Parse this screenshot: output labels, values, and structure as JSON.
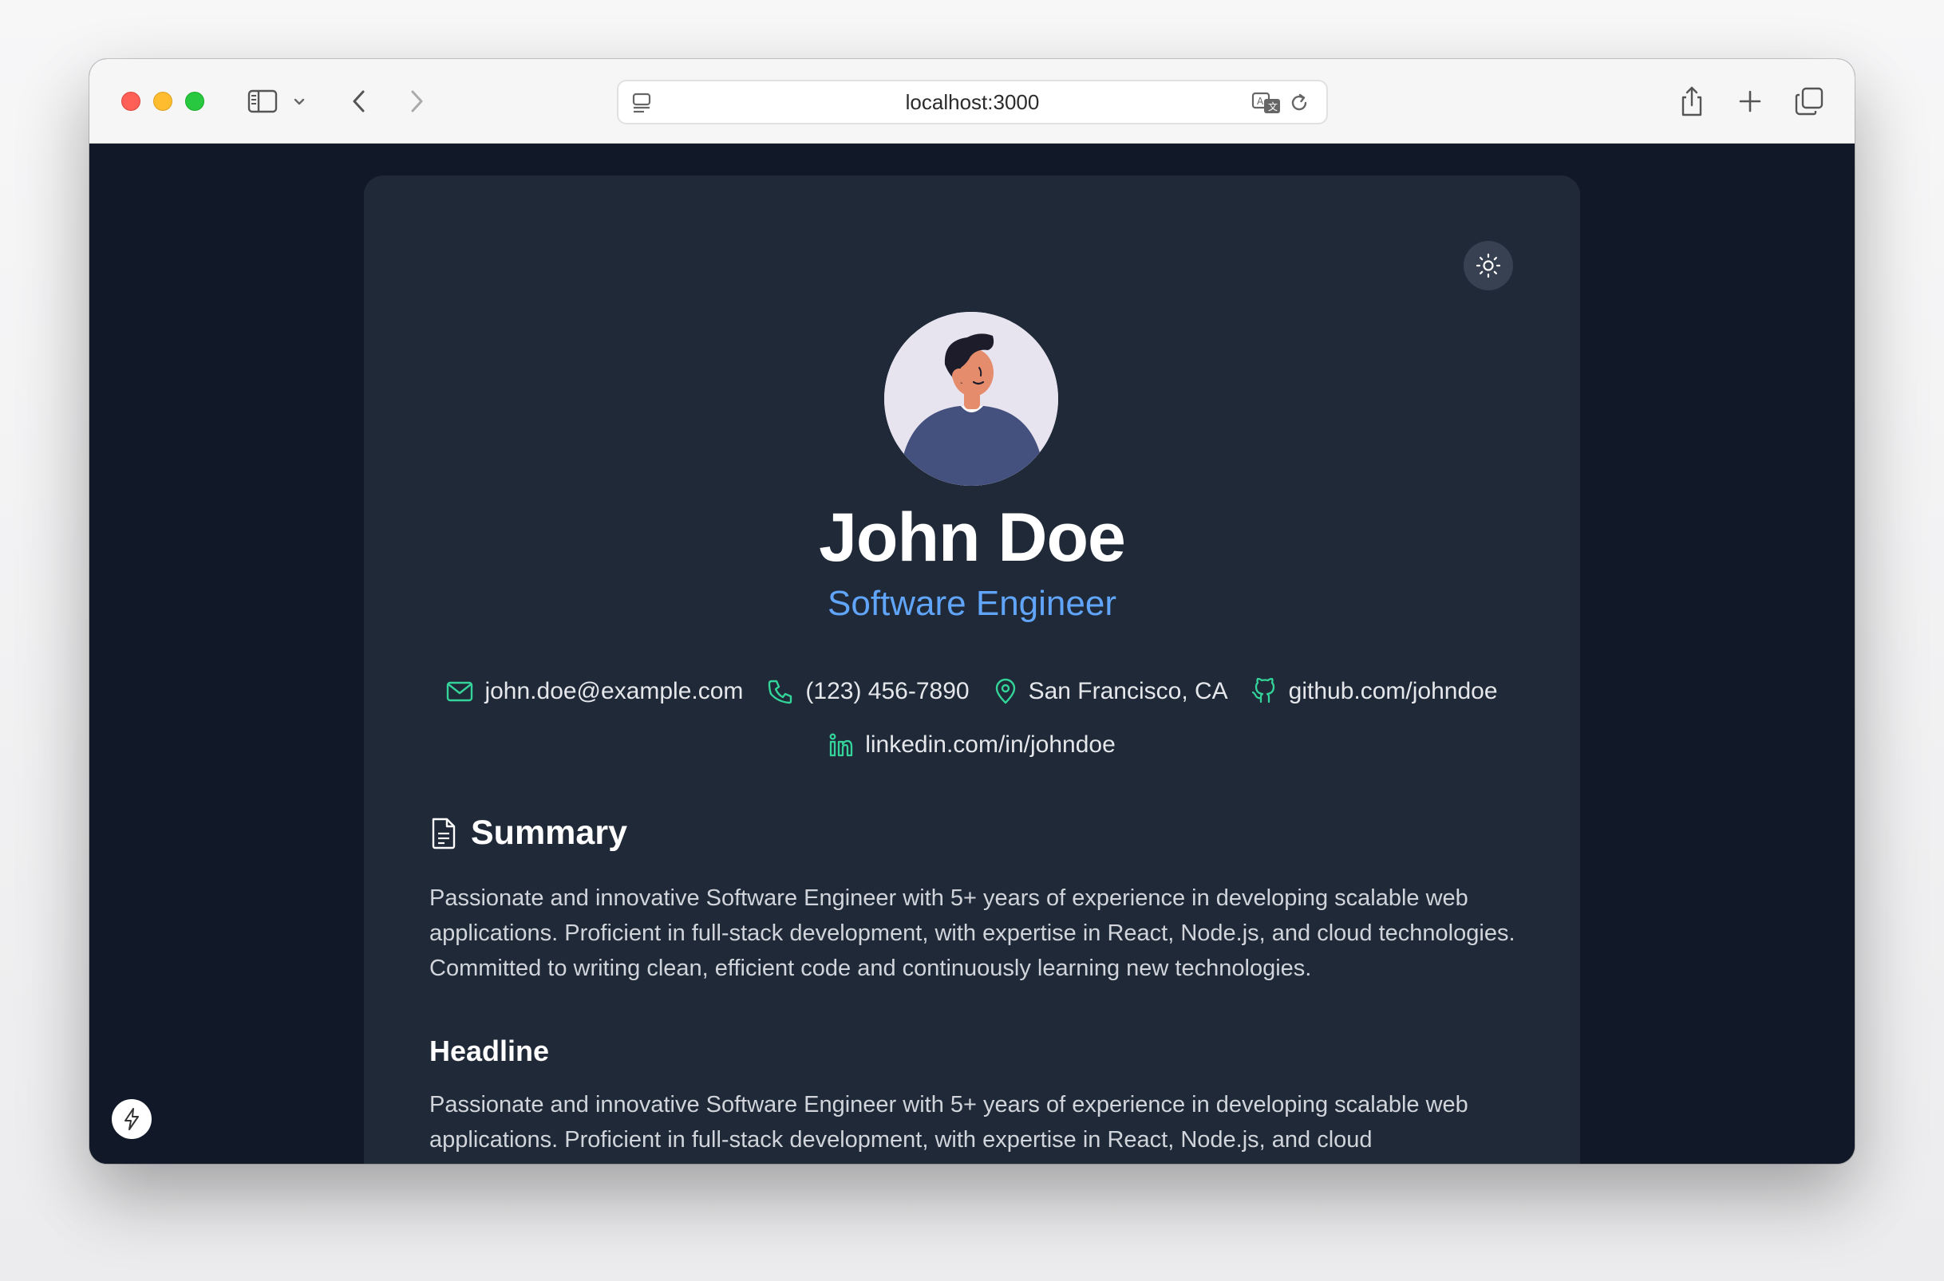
{
  "browser": {
    "url": "localhost:3000"
  },
  "profile": {
    "name": "John Doe",
    "title": "Software Engineer"
  },
  "contacts": {
    "email": "john.doe@example.com",
    "phone": "(123) 456-7890",
    "location": "San Francisco, CA",
    "github": "github.com/johndoe",
    "linkedin": "linkedin.com/in/johndoe"
  },
  "summary": {
    "heading": "Summary",
    "text": "Passionate and innovative Software Engineer with 5+ years of experience in developing scalable web applications. Proficient in full-stack development, with expertise in React, Node.js, and cloud technologies. Committed to writing clean, efficient code and continuously learning new technologies."
  },
  "headline": {
    "heading": "Headline",
    "text": "Passionate and innovative Software Engineer with 5+ years of experience in developing scalable web applications. Proficient in full-stack development, with expertise in React, Node.js, and cloud"
  },
  "colors": {
    "page_bg": "#111827",
    "card_bg": "#1f2937",
    "accent": "#60a5fa",
    "icon": "#34d399"
  }
}
